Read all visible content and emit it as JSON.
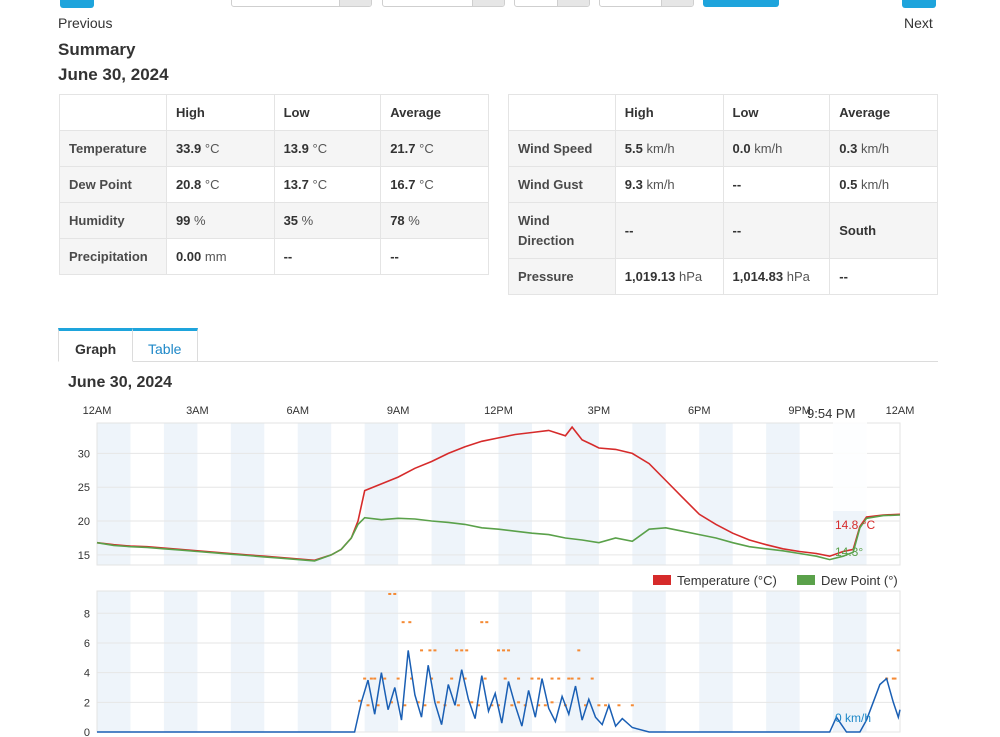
{
  "nav": {
    "previous_label": "Previous",
    "next_label": "Next"
  },
  "summary": {
    "title": "Summary",
    "date": "June 30, 2024",
    "headers": [
      "High",
      "Low",
      "Average"
    ],
    "left_rows": [
      {
        "label": "Temperature",
        "high": "33.9",
        "high_unit": "°C",
        "low": "13.9",
        "low_unit": "°C",
        "avg": "21.7",
        "avg_unit": "°C"
      },
      {
        "label": "Dew Point",
        "high": "20.8",
        "high_unit": "°C",
        "low": "13.7",
        "low_unit": "°C",
        "avg": "16.7",
        "avg_unit": "°C"
      },
      {
        "label": "Humidity",
        "high": "99",
        "high_unit": "%",
        "low": "35",
        "low_unit": "%",
        "avg": "78",
        "avg_unit": "%"
      },
      {
        "label": "Precipitation",
        "high": "0.00",
        "high_unit": "mm",
        "low": "--",
        "low_unit": "",
        "avg": "--",
        "avg_unit": ""
      }
    ],
    "right_rows": [
      {
        "label": "Wind Speed",
        "high": "5.5",
        "high_unit": "km/h",
        "low": "0.0",
        "low_unit": "km/h",
        "avg": "0.3",
        "avg_unit": "km/h"
      },
      {
        "label": "Wind Gust",
        "high": "9.3",
        "high_unit": "km/h",
        "low": "--",
        "low_unit": "",
        "avg": "0.5",
        "avg_unit": "km/h"
      },
      {
        "label": "Wind Direction",
        "high": "--",
        "high_unit": "",
        "low": "--",
        "low_unit": "",
        "avg": "South",
        "avg_unit": ""
      },
      {
        "label": "Pressure",
        "high": "1,019.13",
        "high_unit": "hPa",
        "low": "1,014.83",
        "low_unit": "hPa",
        "avg": "--",
        "avg_unit": ""
      }
    ]
  },
  "tabs": [
    {
      "label": "Graph",
      "active": true
    },
    {
      "label": "Table",
      "active": false
    }
  ],
  "graph": {
    "date": "June 30, 2024",
    "hover_time": "9:54 PM",
    "temp_readout": "14.8 °C",
    "dew_readout": "14.3°",
    "wind_readout": "0 km/h",
    "legend": [
      {
        "label": "Temperature (°C)",
        "color": "#d62b2b"
      },
      {
        "label": "Dew Point (°)",
        "color": "#5aa14a"
      }
    ]
  },
  "colors": {
    "accent": "#1ea4dc",
    "temperature": "#d62b2b",
    "dew_point": "#5aa14a",
    "wind_speed": "#1a5fb4",
    "wind_gust": "#f58a34",
    "band": "#eef4fa"
  },
  "chart_data": [
    {
      "type": "line",
      "x_ticks": [
        "12AM",
        "3AM",
        "6AM",
        "9AM",
        "12PM",
        "3PM",
        "6PM",
        "9PM",
        "12AM"
      ],
      "y_ticks": [
        15,
        20,
        25,
        30
      ],
      "ylim": [
        13.5,
        34.5
      ],
      "x_unit": "hours",
      "series": [
        {
          "name": "Temperature (°C)",
          "color": "#d62b2b",
          "x": [
            0,
            0.5,
            1,
            1.5,
            2,
            2.5,
            3,
            3.5,
            4,
            4.5,
            5,
            5.5,
            6,
            6.5,
            7,
            7.3,
            7.6,
            7.8,
            8,
            8.5,
            9,
            9.5,
            10,
            10.5,
            11,
            11.5,
            12,
            12.5,
            13,
            13.5,
            14,
            14.2,
            14.5,
            14.8,
            15,
            15.5,
            16,
            16.5,
            17,
            17.5,
            18,
            18.5,
            19,
            19.5,
            20,
            20.5,
            21,
            21.5,
            21.9,
            22.3,
            22.6,
            22.8,
            23,
            23.5,
            24
          ],
          "y": [
            16.8,
            16.5,
            16.3,
            16.2,
            16.0,
            15.8,
            15.6,
            15.4,
            15.2,
            15.0,
            14.8,
            14.6,
            14.4,
            14.2,
            15.0,
            15.8,
            17.5,
            20.0,
            24.5,
            25.5,
            26.5,
            27.8,
            28.8,
            30.0,
            31.0,
            31.8,
            32.3,
            32.8,
            33.1,
            33.4,
            32.6,
            33.9,
            32.0,
            31.3,
            30.8,
            30.6,
            30.0,
            28.5,
            26.0,
            23.5,
            21.0,
            19.5,
            18.2,
            17.2,
            16.5,
            15.9,
            15.5,
            15.2,
            14.8,
            15.5,
            15.8,
            19.2,
            20.6,
            20.9,
            21.0
          ]
        },
        {
          "name": "Dew Point (°)",
          "color": "#5aa14a",
          "x": [
            0,
            0.5,
            1,
            1.5,
            2,
            2.5,
            3,
            3.5,
            4,
            4.5,
            5,
            5.5,
            6,
            6.5,
            7,
            7.3,
            7.6,
            7.8,
            8,
            8.5,
            9,
            9.5,
            10,
            10.5,
            11,
            11.5,
            12,
            12.5,
            13,
            13.5,
            14,
            14.5,
            15,
            15.5,
            16,
            16.5,
            17,
            17.5,
            18,
            18.5,
            19,
            19.5,
            20,
            20.5,
            21,
            21.5,
            21.9,
            22.3,
            22.6,
            22.8,
            23,
            23.5,
            24
          ],
          "y": [
            16.8,
            16.4,
            16.2,
            16.1,
            15.9,
            15.7,
            15.5,
            15.3,
            15.1,
            14.9,
            14.7,
            14.5,
            14.3,
            14.1,
            15.0,
            15.8,
            17.5,
            19.5,
            20.5,
            20.2,
            20.4,
            20.3,
            20.0,
            19.8,
            19.5,
            19.0,
            18.8,
            18.5,
            18.2,
            18.0,
            17.5,
            17.2,
            16.8,
            17.5,
            17.0,
            18.8,
            19.0,
            18.5,
            18.0,
            17.5,
            16.8,
            16.2,
            15.9,
            15.6,
            15.2,
            14.8,
            14.3,
            14.8,
            15.4,
            19.0,
            20.4,
            20.8,
            20.9
          ]
        }
      ]
    },
    {
      "type": "line",
      "y_ticks": [
        0,
        2,
        4,
        6,
        8
      ],
      "ylim": [
        0,
        9.5
      ],
      "x_unit": "hours",
      "series": [
        {
          "name": "",
          "color": "#1a5fb4",
          "x": [
            0,
            7.7,
            7.9,
            8.1,
            8.3,
            8.5,
            8.7,
            8.9,
            9.1,
            9.3,
            9.5,
            9.7,
            9.9,
            10.1,
            10.3,
            10.5,
            10.7,
            10.9,
            11.1,
            11.3,
            11.5,
            11.7,
            11.9,
            12.1,
            12.3,
            12.5,
            12.7,
            12.9,
            13.1,
            13.3,
            13.5,
            13.7,
            13.9,
            14.1,
            14.3,
            14.5,
            14.7,
            14.9,
            15.1,
            15.3,
            15.5,
            15.7,
            16,
            16.5,
            21.9,
            22.1,
            22.4,
            22.6,
            22.8,
            23.0,
            23.2,
            23.4,
            23.6,
            23.8,
            23.95,
            24
          ],
          "y": [
            0,
            0,
            2.0,
            3.5,
            1.2,
            4.0,
            1.5,
            3.0,
            0.8,
            5.5,
            2.5,
            1.0,
            4.5,
            2.0,
            0.5,
            3.2,
            1.8,
            4.2,
            2.2,
            0.9,
            3.8,
            1.4,
            2.6,
            0.6,
            3.4,
            1.8,
            0.4,
            2.8,
            1.0,
            3.6,
            1.6,
            0.7,
            2.4,
            1.2,
            3.1,
            0.8,
            2.2,
            1.0,
            0.5,
            1.8,
            0.4,
            0.9,
            0.3,
            0,
            0,
            1.0,
            0,
            0,
            0,
            0.8,
            2.0,
            3.2,
            3.6,
            2.0,
            1.0,
            1.5
          ]
        }
      ],
      "gust_points": {
        "color": "#f58a34",
        "x": [
          7.85,
          8.0,
          8.2,
          8.4,
          8.6,
          8.8,
          9.0,
          9.2,
          9.4,
          9.6,
          9.8,
          10.0,
          10.2,
          10.4,
          10.6,
          10.8,
          11.0,
          11.2,
          11.4,
          11.6,
          11.8,
          12.0,
          12.2,
          12.4,
          12.6,
          12.8,
          13.0,
          13.2,
          13.4,
          13.6,
          13.8,
          14.0,
          14.2,
          14.4,
          14.6,
          14.8,
          15.0,
          15.2,
          15.6,
          16.0,
          8.1,
          8.3,
          9.15,
          9.35,
          9.7,
          9.95,
          10.1,
          11.5,
          11.65,
          12.0,
          12.15,
          14.4,
          8.75,
          8.9,
          10.75,
          10.9,
          11.05,
          12.3,
          12.6,
          13.2,
          13.6,
          14.1,
          23.6,
          23.8,
          23.95,
          23.85
        ],
        "y": [
          2.1,
          3.6,
          3.6,
          1.8,
          3.6,
          2.0,
          3.6,
          1.8,
          3.6,
          2.0,
          1.8,
          3.6,
          2.0,
          1.8,
          3.6,
          1.8,
          3.6,
          2.0,
          1.8,
          3.6,
          1.8,
          1.8,
          3.6,
          1.8,
          2.0,
          1.8,
          3.6,
          1.8,
          1.8,
          2.0,
          3.6,
          1.8,
          3.6,
          3.6,
          1.8,
          3.6,
          1.8,
          1.8,
          1.8,
          1.8,
          1.8,
          3.6,
          7.4,
          7.4,
          5.5,
          5.5,
          5.5,
          7.4,
          7.4,
          5.5,
          5.5,
          5.5,
          9.3,
          9.3,
          5.5,
          5.5,
          5.5,
          5.5,
          3.6,
          3.6,
          3.6,
          3.6,
          3.6,
          3.6,
          5.5,
          3.6
        ]
      }
    }
  ]
}
